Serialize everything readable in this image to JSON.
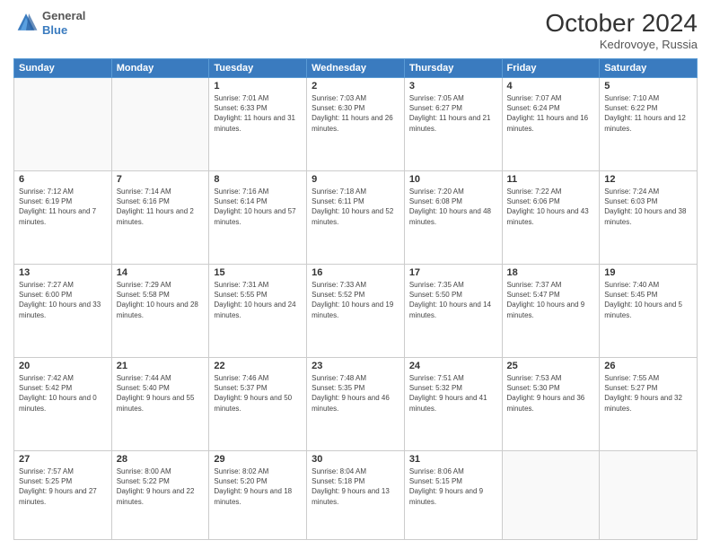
{
  "header": {
    "logo": {
      "general": "General",
      "blue": "Blue"
    },
    "title": "October 2024",
    "location": "Kedrovoye, Russia"
  },
  "days_of_week": [
    "Sunday",
    "Monday",
    "Tuesday",
    "Wednesday",
    "Thursday",
    "Friday",
    "Saturday"
  ],
  "weeks": [
    [
      {
        "day": "",
        "empty": true
      },
      {
        "day": "",
        "empty": true
      },
      {
        "day": "1",
        "sunrise": "7:01 AM",
        "sunset": "6:33 PM",
        "daylight": "11 hours and 31 minutes."
      },
      {
        "day": "2",
        "sunrise": "7:03 AM",
        "sunset": "6:30 PM",
        "daylight": "11 hours and 26 minutes."
      },
      {
        "day": "3",
        "sunrise": "7:05 AM",
        "sunset": "6:27 PM",
        "daylight": "11 hours and 21 minutes."
      },
      {
        "day": "4",
        "sunrise": "7:07 AM",
        "sunset": "6:24 PM",
        "daylight": "11 hours and 16 minutes."
      },
      {
        "day": "5",
        "sunrise": "7:10 AM",
        "sunset": "6:22 PM",
        "daylight": "11 hours and 12 minutes."
      }
    ],
    [
      {
        "day": "6",
        "sunrise": "7:12 AM",
        "sunset": "6:19 PM",
        "daylight": "11 hours and 7 minutes."
      },
      {
        "day": "7",
        "sunrise": "7:14 AM",
        "sunset": "6:16 PM",
        "daylight": "11 hours and 2 minutes."
      },
      {
        "day": "8",
        "sunrise": "7:16 AM",
        "sunset": "6:14 PM",
        "daylight": "10 hours and 57 minutes."
      },
      {
        "day": "9",
        "sunrise": "7:18 AM",
        "sunset": "6:11 PM",
        "daylight": "10 hours and 52 minutes."
      },
      {
        "day": "10",
        "sunrise": "7:20 AM",
        "sunset": "6:08 PM",
        "daylight": "10 hours and 48 minutes."
      },
      {
        "day": "11",
        "sunrise": "7:22 AM",
        "sunset": "6:06 PM",
        "daylight": "10 hours and 43 minutes."
      },
      {
        "day": "12",
        "sunrise": "7:24 AM",
        "sunset": "6:03 PM",
        "daylight": "10 hours and 38 minutes."
      }
    ],
    [
      {
        "day": "13",
        "sunrise": "7:27 AM",
        "sunset": "6:00 PM",
        "daylight": "10 hours and 33 minutes."
      },
      {
        "day": "14",
        "sunrise": "7:29 AM",
        "sunset": "5:58 PM",
        "daylight": "10 hours and 28 minutes."
      },
      {
        "day": "15",
        "sunrise": "7:31 AM",
        "sunset": "5:55 PM",
        "daylight": "10 hours and 24 minutes."
      },
      {
        "day": "16",
        "sunrise": "7:33 AM",
        "sunset": "5:52 PM",
        "daylight": "10 hours and 19 minutes."
      },
      {
        "day": "17",
        "sunrise": "7:35 AM",
        "sunset": "5:50 PM",
        "daylight": "10 hours and 14 minutes."
      },
      {
        "day": "18",
        "sunrise": "7:37 AM",
        "sunset": "5:47 PM",
        "daylight": "10 hours and 9 minutes."
      },
      {
        "day": "19",
        "sunrise": "7:40 AM",
        "sunset": "5:45 PM",
        "daylight": "10 hours and 5 minutes."
      }
    ],
    [
      {
        "day": "20",
        "sunrise": "7:42 AM",
        "sunset": "5:42 PM",
        "daylight": "10 hours and 0 minutes."
      },
      {
        "day": "21",
        "sunrise": "7:44 AM",
        "sunset": "5:40 PM",
        "daylight": "9 hours and 55 minutes."
      },
      {
        "day": "22",
        "sunrise": "7:46 AM",
        "sunset": "5:37 PM",
        "daylight": "9 hours and 50 minutes."
      },
      {
        "day": "23",
        "sunrise": "7:48 AM",
        "sunset": "5:35 PM",
        "daylight": "9 hours and 46 minutes."
      },
      {
        "day": "24",
        "sunrise": "7:51 AM",
        "sunset": "5:32 PM",
        "daylight": "9 hours and 41 minutes."
      },
      {
        "day": "25",
        "sunrise": "7:53 AM",
        "sunset": "5:30 PM",
        "daylight": "9 hours and 36 minutes."
      },
      {
        "day": "26",
        "sunrise": "7:55 AM",
        "sunset": "5:27 PM",
        "daylight": "9 hours and 32 minutes."
      }
    ],
    [
      {
        "day": "27",
        "sunrise": "7:57 AM",
        "sunset": "5:25 PM",
        "daylight": "9 hours and 27 minutes."
      },
      {
        "day": "28",
        "sunrise": "8:00 AM",
        "sunset": "5:22 PM",
        "daylight": "9 hours and 22 minutes."
      },
      {
        "day": "29",
        "sunrise": "8:02 AM",
        "sunset": "5:20 PM",
        "daylight": "9 hours and 18 minutes."
      },
      {
        "day": "30",
        "sunrise": "8:04 AM",
        "sunset": "5:18 PM",
        "daylight": "9 hours and 13 minutes."
      },
      {
        "day": "31",
        "sunrise": "8:06 AM",
        "sunset": "5:15 PM",
        "daylight": "9 hours and 9 minutes."
      },
      {
        "day": "",
        "empty": true
      },
      {
        "day": "",
        "empty": true
      }
    ]
  ]
}
